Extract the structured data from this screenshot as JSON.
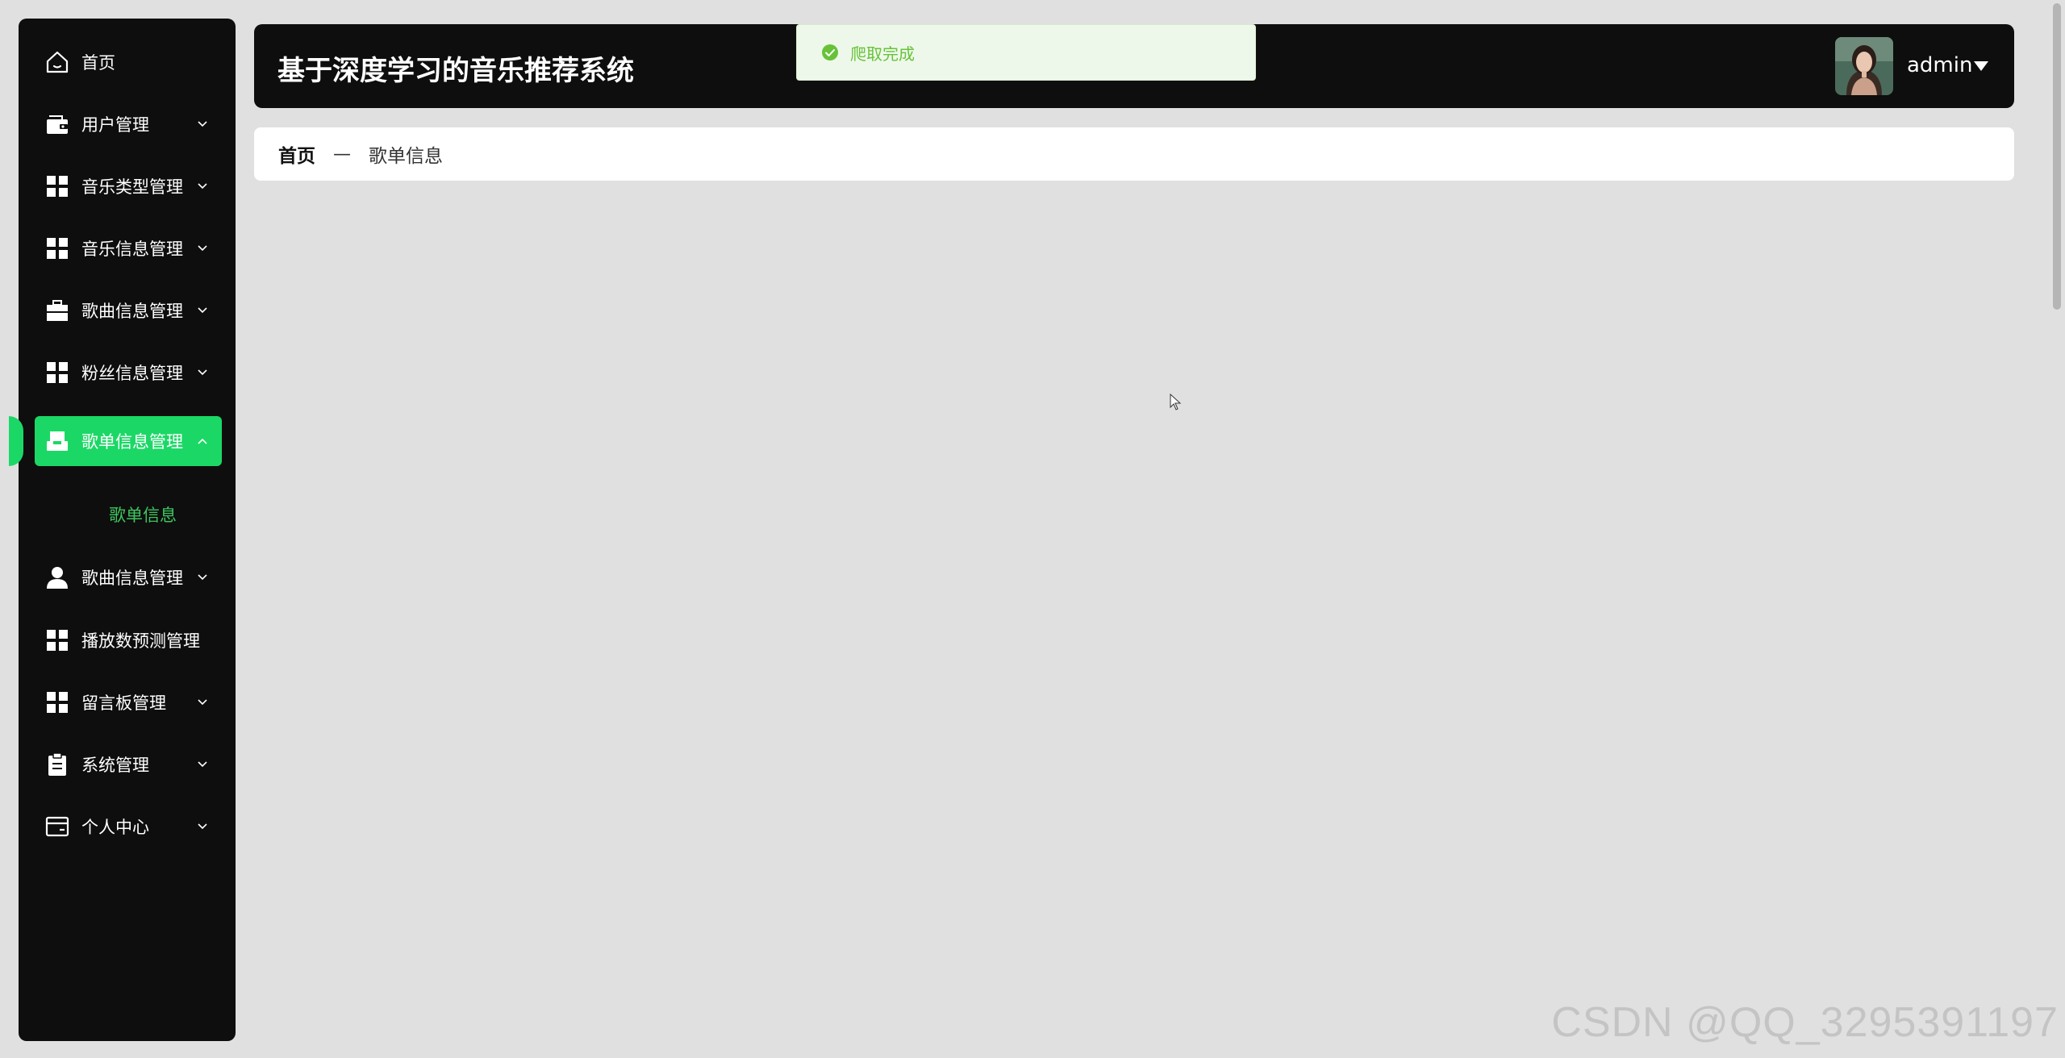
{
  "header": {
    "title": "基于深度学习的音乐推荐系统",
    "username": "admin"
  },
  "toast": {
    "message": "爬取完成"
  },
  "sidebar": {
    "items": [
      {
        "label": "首页",
        "icon": "home-icon"
      },
      {
        "label": "用户管理",
        "icon": "wallet-icon"
      },
      {
        "label": "音乐类型管理",
        "icon": "grid-icon"
      },
      {
        "label": "音乐信息管理",
        "icon": "grid-icon"
      },
      {
        "label": "歌曲信息管理",
        "icon": "briefcase-icon"
      },
      {
        "label": "粉丝信息管理",
        "icon": "grid-icon"
      },
      {
        "label": "歌单信息管理",
        "icon": "inbox-icon"
      },
      {
        "label": "歌曲信息管理",
        "icon": "user-icon"
      },
      {
        "label": "播放数预测管理",
        "icon": "grid-icon"
      },
      {
        "label": "留言板管理",
        "icon": "grid-icon"
      },
      {
        "label": "系统管理",
        "icon": "clipboard-icon"
      },
      {
        "label": "个人中心",
        "icon": "card-icon"
      }
    ],
    "active_submenu": "歌单信息"
  },
  "breadcrumb": {
    "home": "首页",
    "separator": "—",
    "current": "歌单信息"
  },
  "watermark": "CSDN @QQ_3295391197",
  "colors": {
    "accent": "#1bd866",
    "sidebar_bg": "#0e0e0e",
    "toast_text": "#67c23a"
  }
}
